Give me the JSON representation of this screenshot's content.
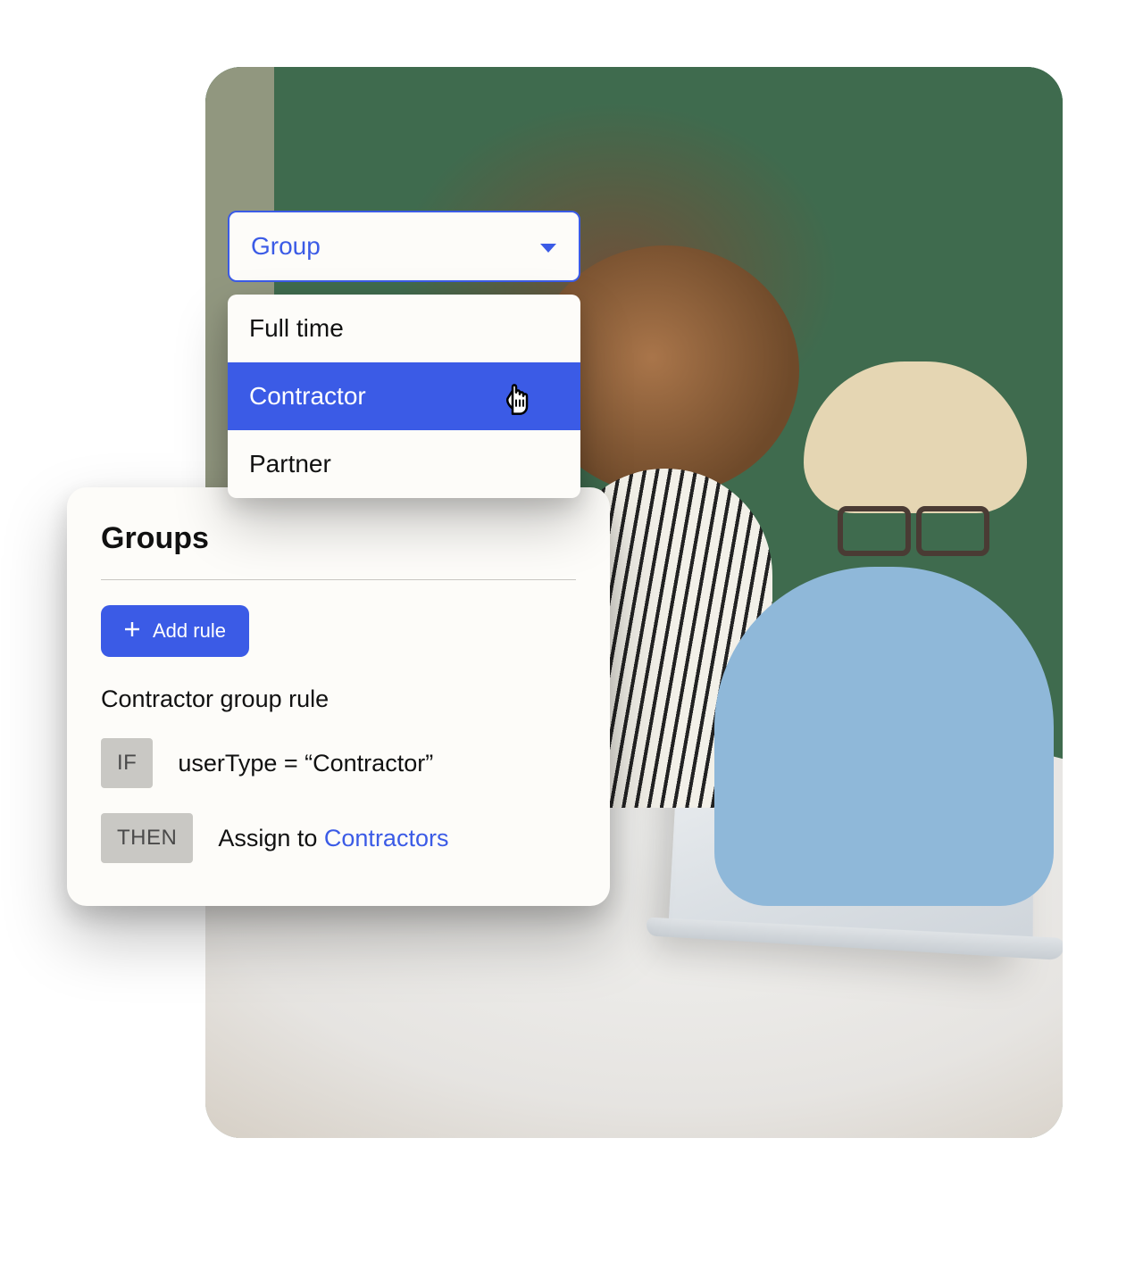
{
  "dropdown": {
    "label": "Group",
    "items": [
      {
        "label": "Full time"
      },
      {
        "label": "Contractor"
      },
      {
        "label": "Partner"
      }
    ]
  },
  "groups": {
    "title": "Groups",
    "addRuleLabel": "Add rule",
    "ruleTitle": "Contractor group rule",
    "ifToken": "IF",
    "ifExpression": "userType = “Contractor”",
    "thenToken": "THEN",
    "thenPrefix": "Assign to ",
    "thenLink": "Contractors"
  }
}
